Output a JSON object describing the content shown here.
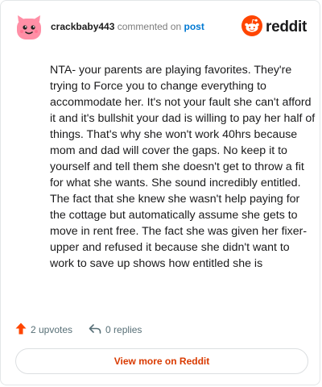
{
  "comment": {
    "username": "crackbaby443",
    "action_text": "commented on",
    "post_link_label": "post",
    "body": "NTA- your parents are playing favorites. They're trying to Force you to change everything to accommodate her. It's not your fault she can't afford it and it's bullshit your dad is willing to pay her half of things. That's why she won't work 40hrs because mom and dad will cover the gaps. No keep it to yourself and tell them she doesn't get to throw a fit for what she wants. She sound incredibly entitled. The fact that she knew she wasn't help paying for the cottage but automatically assume she gets to move in rent free. The fact she was given her fixer-upper and refused it because she didn't want to work to save up shows how entitled she is"
  },
  "brand": {
    "name": "reddit",
    "icon": "reddit-snoo-icon",
    "color": "#ff4500"
  },
  "avatar": {
    "icon": "pink-snoo-avatar-icon",
    "color": "#ff8fa6"
  },
  "actions": {
    "upvotes_label": "2 upvotes",
    "upvote_icon": "upvote-arrow-icon",
    "upvote_color": "#ff4500",
    "replies_label": "0 replies",
    "reply_icon": "reply-arrow-icon"
  },
  "footer": {
    "view_more_label": "View more on Reddit",
    "accent": "#d93a00"
  }
}
